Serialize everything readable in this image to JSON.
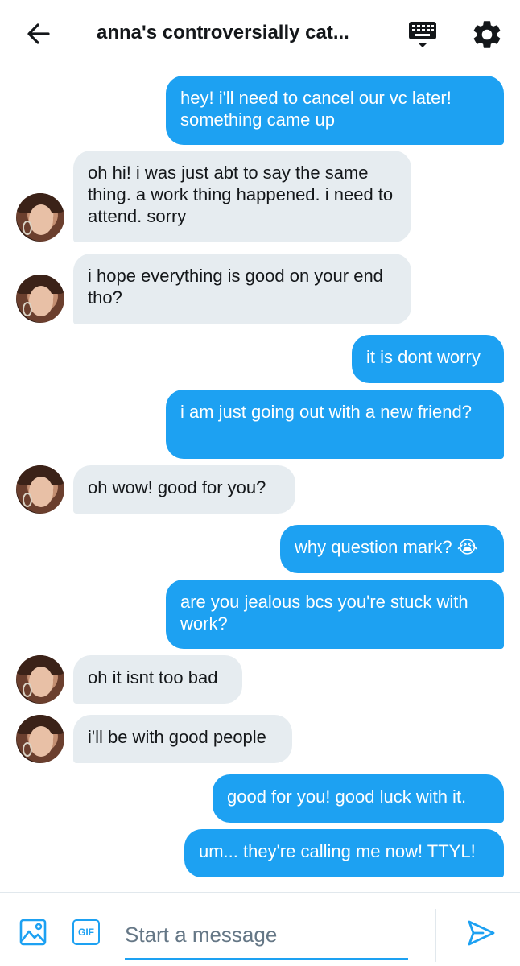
{
  "header": {
    "title": "anna's controversially cat..."
  },
  "messages": [
    {
      "side": "out",
      "text": "hey! i'll need to cancel our vc later! something came up"
    },
    {
      "side": "in",
      "text": "oh hi! i was just abt to say the same thing. a work thing happened. i need to attend. sorry"
    },
    {
      "side": "in",
      "text": "i hope everything is good on your end tho?"
    },
    {
      "side": "out",
      "text": "it is dont worry"
    },
    {
      "side": "out",
      "text": "i am just going out with a new friend?"
    },
    {
      "side": "in",
      "text": "oh wow! good for you?"
    },
    {
      "side": "out",
      "text": "why question mark? 😭"
    },
    {
      "side": "out",
      "text": "are you jealous bcs you're stuck with work?"
    },
    {
      "side": "in",
      "text": "oh it isnt too bad"
    },
    {
      "side": "in",
      "text": "i'll be with good people"
    },
    {
      "side": "out",
      "text": "good for you! good luck with it."
    },
    {
      "side": "out",
      "text": "um... they're calling me now! TTYL!"
    }
  ],
  "composer": {
    "placeholder": "Start a message",
    "gif_label": "GIF"
  },
  "icons": {
    "back": "back-arrow-icon",
    "keyboard": "keyboard-icon",
    "settings": "gear-icon",
    "image": "image-icon",
    "gif": "gif-icon",
    "send": "send-icon"
  },
  "colors": {
    "accent": "#1da1f2",
    "incoming_bubble": "#e6ecf0",
    "text": "#14171a",
    "placeholder": "#657786"
  }
}
